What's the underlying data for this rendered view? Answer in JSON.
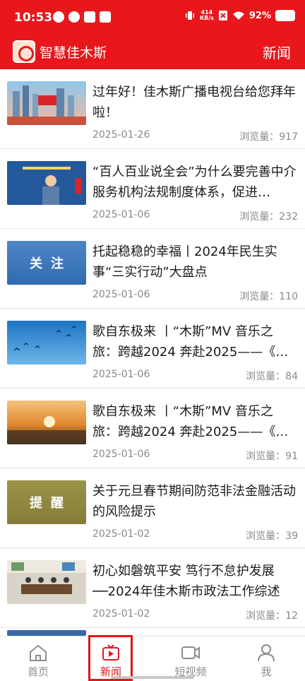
{
  "status_bar": {
    "time": "10:53",
    "speed_value": "414",
    "speed_unit": "KB/s",
    "battery": "92%"
  },
  "header": {
    "app_name": "智慧佳木斯",
    "right_label": "新闻"
  },
  "news": [
    {
      "title": "过年好！佳木斯广播电视台给您拜年啦！",
      "date": "2025-01-26",
      "views_label": "浏览量：917",
      "thumb_text": "",
      "thumb_style": "city"
    },
    {
      "title": "“百人百业说全会”为什么要完善中介服务机构法规制度体系，促进…",
      "date": "2025-01-06",
      "views_label": "浏览量：232",
      "thumb_text": "",
      "thumb_style": "speaker"
    },
    {
      "title": "托起稳稳的幸福丨2024年民生实事“三实行动”大盘点",
      "date": "2025-01-06",
      "views_label": "浏览量：110",
      "thumb_text": "关注",
      "thumb_style": "focus"
    },
    {
      "title": "歌自东极来 丨“木斯”MV 音乐之旅：跨越2024 奔赴2025——《…",
      "date": "2025-01-06",
      "views_label": "浏览量：84",
      "thumb_text": "",
      "thumb_style": "sky"
    },
    {
      "title": "歌自东极来 丨“木斯”MV 音乐之旅：跨越2024 奔赴2025——《…",
      "date": "2025-01-06",
      "views_label": "浏览量：91",
      "thumb_text": "",
      "thumb_style": "sunset"
    },
    {
      "title": "关于元旦春节期间防范非法金融活动的风险提示",
      "date": "2025-01-02",
      "views_label": "浏览量：39",
      "thumb_text": "提醒",
      "thumb_style": "reminder"
    },
    {
      "title": "初心如磐筑平安 笃行不怠护发展──2024年佳木斯市政法工作综述",
      "date": "2025-01-02",
      "views_label": "浏览量：12",
      "thumb_text": "",
      "thumb_style": "meeting"
    }
  ],
  "bottom_nav": [
    {
      "label": "首页",
      "icon": "home-icon",
      "active": false
    },
    {
      "label": "新闻",
      "icon": "tv-icon",
      "active": true
    },
    {
      "label": "短视频",
      "icon": "video-camera-icon",
      "active": false
    },
    {
      "label": "我",
      "icon": "user-icon",
      "active": false
    }
  ],
  "colors": {
    "brand_red": "#e8171b",
    "inactive_gray": "#8c8c8c"
  }
}
